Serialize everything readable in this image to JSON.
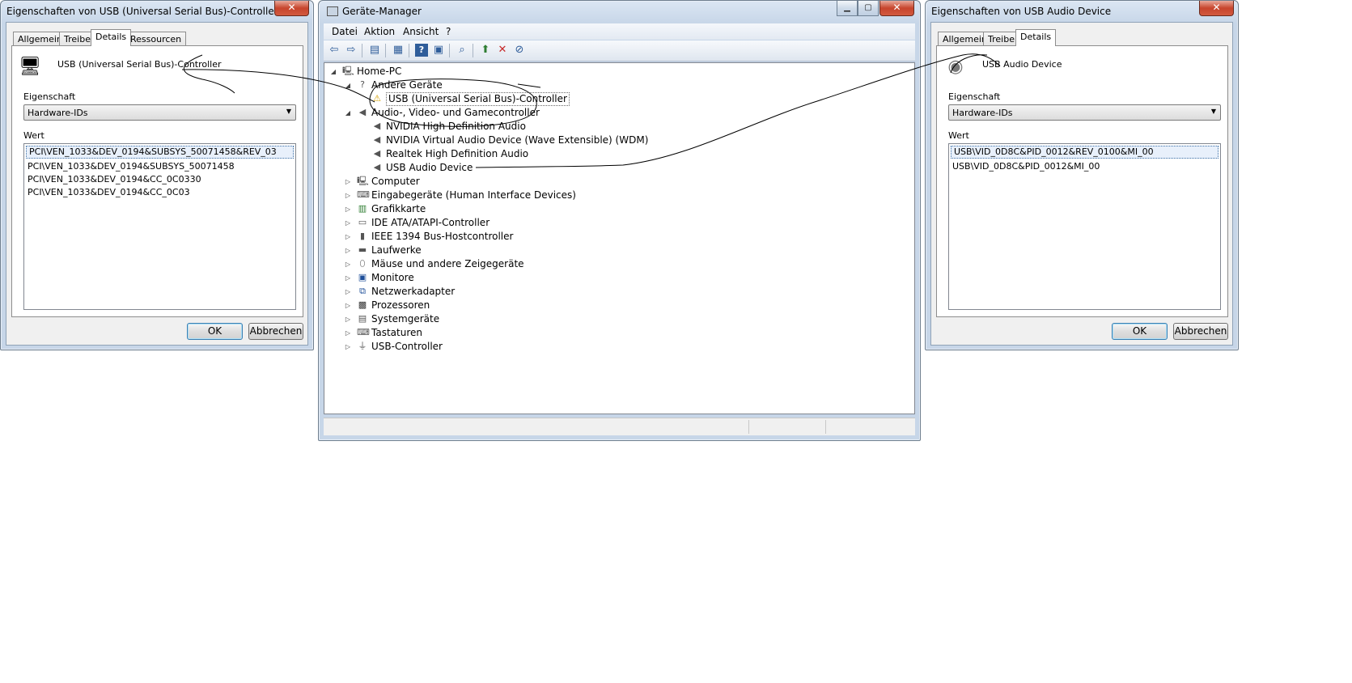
{
  "left_dialog": {
    "title": "Eigenschaften von USB (Universal Serial Bus)-Controller",
    "close_label": "✕",
    "tabs": [
      "Allgemein",
      "Treiber",
      "Details",
      "Ressourcen"
    ],
    "active_tab": "Details",
    "device_name": "USB (Universal Serial Bus)-Controller",
    "property_label": "Eigenschaft",
    "property_value": "Hardware-IDs",
    "value_label": "Wert",
    "values": [
      "PCI\\VEN_1033&DEV_0194&SUBSYS_50071458&REV_03",
      "PCI\\VEN_1033&DEV_0194&SUBSYS_50071458",
      "PCI\\VEN_1033&DEV_0194&CC_0C0330",
      "PCI\\VEN_1033&DEV_0194&CC_0C03"
    ],
    "ok_label": "OK",
    "cancel_label": "Abbrechen"
  },
  "device_manager": {
    "title": "Geräte-Manager",
    "minimize_label": "▁",
    "maximize_label": "▢",
    "close_label": "✕",
    "menu": [
      "Datei",
      "Aktion",
      "Ansicht",
      "?"
    ],
    "toolbar_icons": [
      "back-icon",
      "forward-icon",
      "console-tree-icon",
      "properties-icon",
      "help-icon",
      "action-pane-icon",
      "scan-hardware-icon",
      "update-driver-icon",
      "uninstall-icon",
      "disable-icon"
    ],
    "tree": [
      {
        "label": "Home-PC",
        "level": 0,
        "expanded": true,
        "icon": "computer-icon"
      },
      {
        "label": "Andere Geräte",
        "level": 1,
        "expanded": true,
        "icon": "unknown-device-icon"
      },
      {
        "label": "USB (Universal Serial Bus)-Controller",
        "level": 2,
        "icon": "warning-device-icon"
      },
      {
        "label": "Audio-, Video- und Gamecontroller",
        "level": 1,
        "expanded": true,
        "icon": "speaker-icon"
      },
      {
        "label": "NVIDIA High Definition Audio",
        "level": 2,
        "icon": "speaker-icon"
      },
      {
        "label": "NVIDIA Virtual Audio Device (Wave Extensible) (WDM)",
        "level": 2,
        "icon": "speaker-icon"
      },
      {
        "label": "Realtek High Definition Audio",
        "level": 2,
        "icon": "speaker-icon"
      },
      {
        "label": "USB Audio Device",
        "level": 2,
        "icon": "speaker-icon"
      },
      {
        "label": "Computer",
        "level": 1,
        "expanded": false,
        "icon": "computer-icon"
      },
      {
        "label": "Eingabegeräte (Human Interface Devices)",
        "level": 1,
        "expanded": false,
        "icon": "hid-icon"
      },
      {
        "label": "Grafikkarte",
        "level": 1,
        "expanded": false,
        "icon": "display-adapter-icon"
      },
      {
        "label": "IDE ATA/ATAPI-Controller",
        "level": 1,
        "expanded": false,
        "icon": "ide-controller-icon"
      },
      {
        "label": "IEEE 1394 Bus-Hostcontroller",
        "level": 1,
        "expanded": false,
        "icon": "firewire-icon"
      },
      {
        "label": "Laufwerke",
        "level": 1,
        "expanded": false,
        "icon": "disk-drive-icon"
      },
      {
        "label": "Mäuse und andere Zeigegeräte",
        "level": 1,
        "expanded": false,
        "icon": "mouse-icon"
      },
      {
        "label": "Monitore",
        "level": 1,
        "expanded": false,
        "icon": "monitor-icon"
      },
      {
        "label": "Netzwerkadapter",
        "level": 1,
        "expanded": false,
        "icon": "network-adapter-icon"
      },
      {
        "label": "Prozessoren",
        "level": 1,
        "expanded": false,
        "icon": "processor-icon"
      },
      {
        "label": "Systemgeräte",
        "level": 1,
        "expanded": false,
        "icon": "system-device-icon"
      },
      {
        "label": "Tastaturen",
        "level": 1,
        "expanded": false,
        "icon": "keyboard-icon"
      },
      {
        "label": "USB-Controller",
        "level": 1,
        "expanded": false,
        "icon": "usb-icon"
      }
    ]
  },
  "right_dialog": {
    "title": "Eigenschaften von USB Audio Device",
    "close_label": "✕",
    "tabs": [
      "Allgemein",
      "Treiber",
      "Details"
    ],
    "active_tab": "Details",
    "device_name": "USB Audio Device",
    "property_label": "Eigenschaft",
    "property_value": "Hardware-IDs",
    "value_label": "Wert",
    "values": [
      "USB\\VID_0D8C&PID_0012&REV_0100&MI_00",
      "USB\\VID_0D8C&PID_0012&MI_00"
    ],
    "ok_label": "OK",
    "cancel_label": "Abbrechen"
  },
  "colors": {
    "title_gradient_top": "#dbe6f3",
    "close_red": "#c7452d",
    "selection_border": "#3a6ea5",
    "annotation_ink": "#000000"
  }
}
